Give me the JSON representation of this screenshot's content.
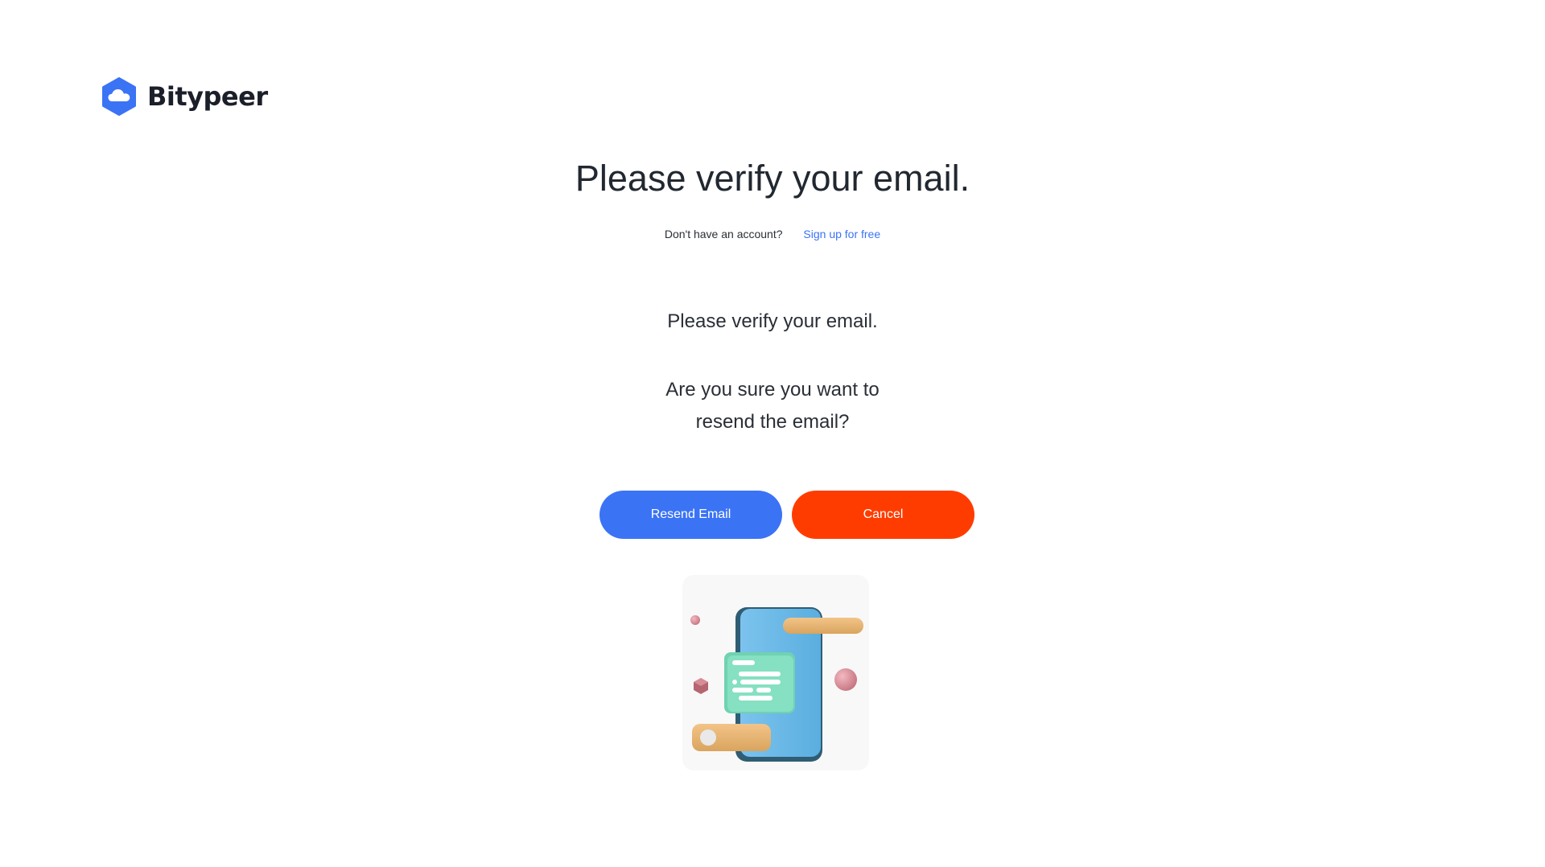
{
  "brand": {
    "name": "Bitypeer",
    "logo_icon": "cloud-hexagon-icon",
    "accent": "#3b73f5"
  },
  "main": {
    "title": "Please verify your email.",
    "signup_prompt": "Don't have an account?",
    "signup_link": "Sign up for free",
    "message_primary": "Please verify your email.",
    "message_confirm_line1": "Are you sure you want to",
    "message_confirm_line2": "resend the email?"
  },
  "actions": {
    "resend_label": "Resend Email",
    "cancel_label": "Cancel",
    "resend_color": "#3b73f5",
    "cancel_color": "#ff3c00"
  },
  "illustration": {
    "icon": "phone-message-illustration"
  }
}
